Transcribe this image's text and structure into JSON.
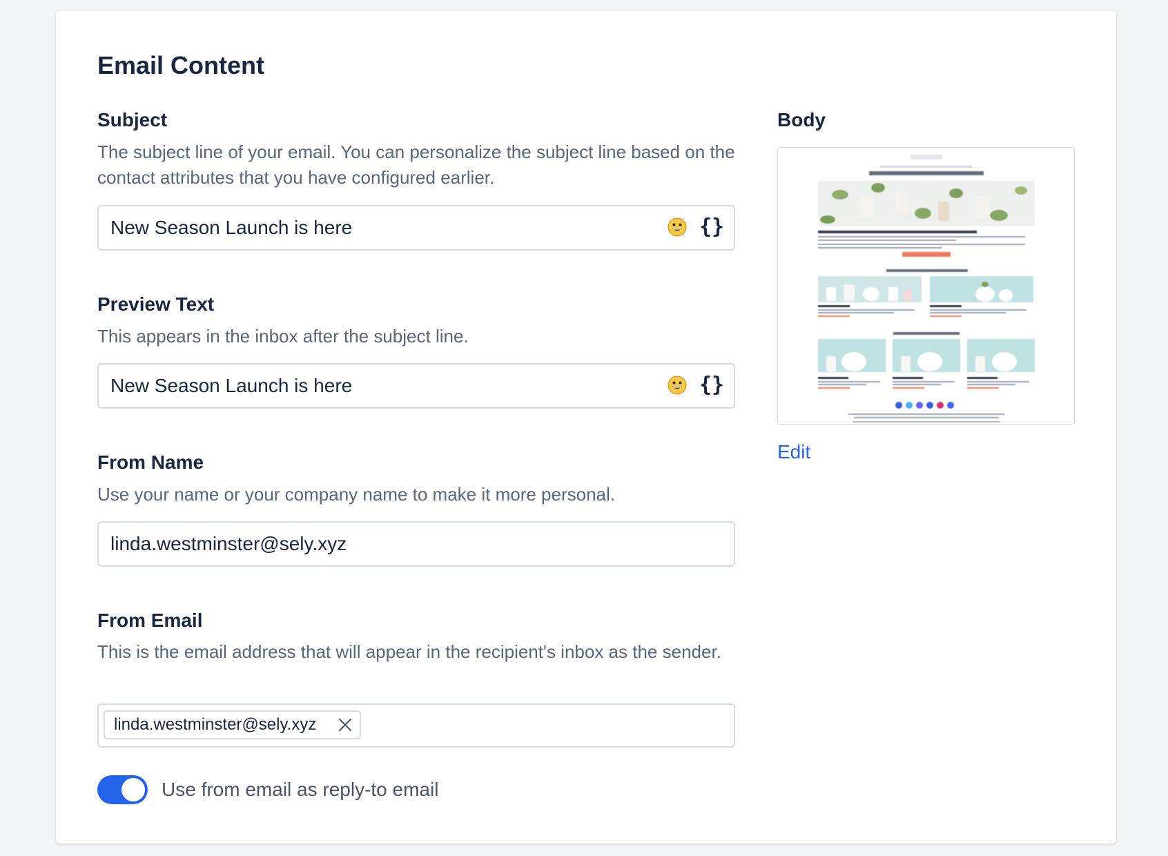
{
  "section": {
    "title": "Email Content"
  },
  "subject": {
    "label": "Subject",
    "help": "The subject line of your email. You can personalize the subject line based on the contact attributes that you have configured earlier.",
    "value": "New Season Launch is here",
    "icons": [
      "emoji-icon",
      "braces-icon"
    ]
  },
  "preview_text": {
    "label": "Preview Text",
    "help": "This appears in the inbox after the subject line.",
    "value": "New Season Launch is here",
    "icons": [
      "emoji-icon",
      "braces-icon"
    ]
  },
  "from_name": {
    "label": "From Name",
    "help": "Use your name or your company name to make it more personal.",
    "value": "linda.westminster@sely.xyz"
  },
  "from_email": {
    "label": "From Email",
    "help": "This is the email address that will appear in the recipient's inbox as the sender.",
    "chip": "linda.westminster@sely.xyz"
  },
  "reply_to_toggle": {
    "label": "Use from email as reply-to email",
    "on": true
  },
  "body": {
    "label": "Body",
    "edit_label": "Edit"
  },
  "colors": {
    "accent": "#2563eb",
    "heading": "#1a2540",
    "muted": "#5b6479",
    "border": "#d6dbe3",
    "background": "#f3f4f6"
  }
}
